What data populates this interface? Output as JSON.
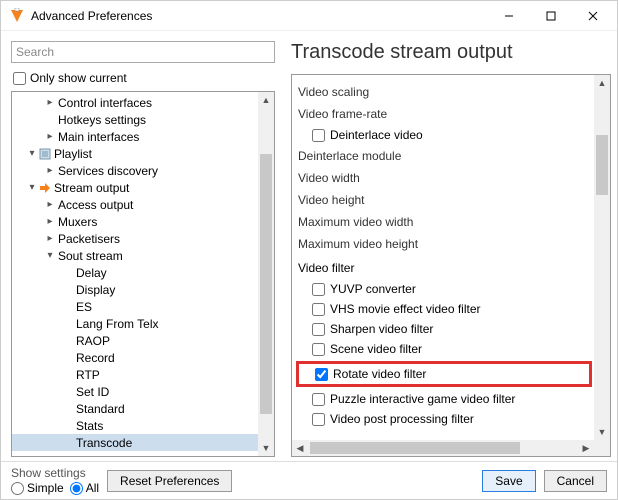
{
  "window": {
    "title": "Advanced Preferences"
  },
  "search": {
    "placeholder": "Search"
  },
  "onlyCurrent": {
    "label": "Only show current",
    "checked": false
  },
  "tree": [
    {
      "label": "Control interfaces",
      "indent": 1,
      "chev": "right"
    },
    {
      "label": "Hotkeys settings",
      "indent": 1
    },
    {
      "label": "Main interfaces",
      "indent": 1,
      "chev": "right"
    },
    {
      "label": "Playlist",
      "indent": 0,
      "chev": "down",
      "icon": "playlist"
    },
    {
      "label": "Services discovery",
      "indent": 1,
      "chev": "right"
    },
    {
      "label": "Stream output",
      "indent": 0,
      "chev": "down",
      "icon": "stream"
    },
    {
      "label": "Access output",
      "indent": 1,
      "chev": "right"
    },
    {
      "label": "Muxers",
      "indent": 1,
      "chev": "right"
    },
    {
      "label": "Packetisers",
      "indent": 1,
      "chev": "right"
    },
    {
      "label": "Sout stream",
      "indent": 1,
      "chev": "down"
    },
    {
      "label": "Delay",
      "indent": 2
    },
    {
      "label": "Display",
      "indent": 2
    },
    {
      "label": "ES",
      "indent": 2
    },
    {
      "label": "Lang From Telx",
      "indent": 2
    },
    {
      "label": "RAOP",
      "indent": 2
    },
    {
      "label": "Record",
      "indent": 2
    },
    {
      "label": "RTP",
      "indent": 2
    },
    {
      "label": "Set ID",
      "indent": 2
    },
    {
      "label": "Standard",
      "indent": 2
    },
    {
      "label": "Stats",
      "indent": 2
    },
    {
      "label": "Transcode",
      "indent": 2,
      "selected": true
    }
  ],
  "panel": {
    "title": "Transcode stream output",
    "items": [
      {
        "type": "label",
        "text": "Video scaling"
      },
      {
        "type": "label",
        "text": "Video frame-rate"
      },
      {
        "type": "check",
        "text": "Deinterlace video",
        "checked": false,
        "indent": 1
      },
      {
        "type": "label",
        "text": "Deinterlace module"
      },
      {
        "type": "label",
        "text": "Video width"
      },
      {
        "type": "label",
        "text": "Video height"
      },
      {
        "type": "label",
        "text": "Maximum video width"
      },
      {
        "type": "label",
        "text": "Maximum video height"
      },
      {
        "type": "group",
        "text": "Video filter"
      },
      {
        "type": "check",
        "text": "YUVP converter",
        "checked": false,
        "indent": 1
      },
      {
        "type": "check",
        "text": "VHS movie effect video filter",
        "checked": false,
        "indent": 1
      },
      {
        "type": "check",
        "text": "Sharpen video filter",
        "checked": false,
        "indent": 1
      },
      {
        "type": "check",
        "text": "Scene video filter",
        "checked": false,
        "indent": 1
      },
      {
        "type": "check",
        "text": "Rotate video filter",
        "checked": true,
        "indent": 1,
        "highlight": true
      },
      {
        "type": "check",
        "text": "Puzzle interactive game video filter",
        "checked": false,
        "indent": 1
      },
      {
        "type": "check",
        "text": "Video post processing filter",
        "checked": false,
        "indent": 1
      }
    ]
  },
  "footer": {
    "showSettings": "Show settings",
    "simple": "Simple",
    "all": "All",
    "selected": "all",
    "reset": "Reset Preferences",
    "save": "Save",
    "cancel": "Cancel"
  }
}
